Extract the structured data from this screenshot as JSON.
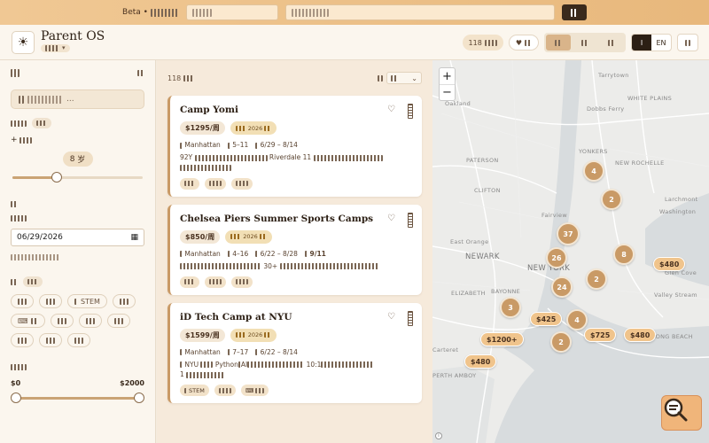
{
  "topbar": {
    "beta_label": "Beta •",
    "search_placeholder": "",
    "location_placeholder": ""
  },
  "header": {
    "title": "Parent OS",
    "subtitle_arrow": "▾",
    "results_badge": "118",
    "lang_active": "I",
    "lang_other": "EN"
  },
  "sidebar": {
    "search_placeholder": "...",
    "add_child": "+",
    "age_value": "8",
    "age_unit": "岁",
    "date_value": "06/29/2026",
    "tags": [
      "",
      "",
      "STEM",
      "",
      "",
      "",
      "",
      "",
      "",
      "",
      ""
    ],
    "price_min": "$0",
    "price_max": "$2000"
  },
  "list": {
    "count": "118",
    "camps": [
      {
        "title": "Camp Yomi",
        "price": "$1295/",
        "price_unit": "周",
        "year": "2026",
        "area": "Manhattan",
        "ages": "5–11",
        "dates": "6/29 – 8/14",
        "desc_a": "92Y",
        "desc_b": "Riverdale 11",
        "tags": [
          "",
          "",
          ""
        ]
      },
      {
        "title": "Chelsea Piers Summer Sports Camps",
        "price": "$850",
        "price_unit": "/周",
        "year": "2026",
        "area": "Manhattan",
        "ages": "4–16",
        "dates": "6/22 – 8/28",
        "extra": "9/11",
        "desc_a": "",
        "desc_b": "30+",
        "tags": [
          "",
          "",
          ""
        ]
      },
      {
        "title": "iD Tech Camp at NYU",
        "price": "$1599/",
        "price_unit": "周",
        "year": "2026",
        "area": "Manhattan",
        "ages": "7–17",
        "dates": "6/22 – 8/14",
        "desc_a": "NYU",
        "desc_b": "Python",
        "desc_c": "AI",
        "desc_d": "10:1",
        "desc_e": "1",
        "tags": [
          "STEM",
          "",
          ""
        ]
      }
    ]
  },
  "map": {
    "labels": [
      "Tarrytown",
      "WHITE PLAINS",
      "Oakland",
      "Dobbs Ferry",
      "YONKERS",
      "NEW ROCHELLE",
      "PATERSON",
      "CLIFTON",
      "Fairview",
      "Larchmont",
      "Washington",
      "East Orange",
      "NEWARK",
      "NEW YORK",
      "ELIZABETH",
      "BAYONNE",
      "Glen Cove",
      "Valley Stream",
      "LONG BEACH",
      "Carteret",
      "PERTH AMBOY"
    ],
    "clusters": [
      "4",
      "2",
      "37",
      "8",
      "26",
      "2",
      "24",
      "3",
      "4",
      "2"
    ],
    "price_pins": [
      "$480",
      "$425",
      "$1200+",
      "$725",
      "$480",
      "$480"
    ],
    "zoom_in": "+",
    "zoom_out": "−",
    "attribution": "i"
  },
  "colors": {
    "accent": "#c99a66",
    "dark": "#3a2a1c",
    "banner": "#f0c894"
  }
}
